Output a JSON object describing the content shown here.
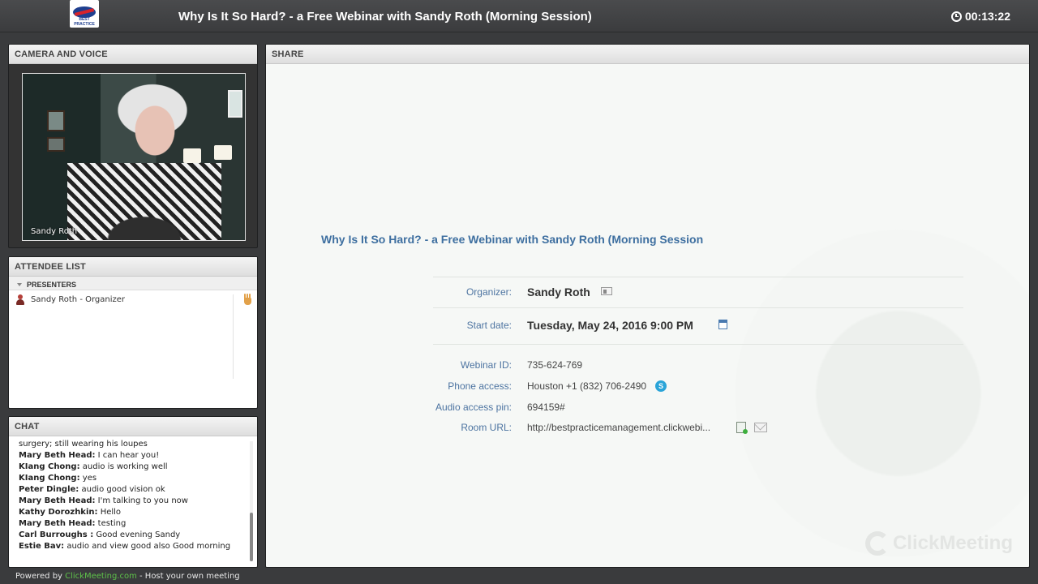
{
  "header": {
    "logo_text": "BEST PRACTICE",
    "title": "Why Is It So Hard? - a Free Webinar with Sandy Roth (Morning Session)",
    "timer": "00:13:22"
  },
  "camera": {
    "header": "CAMERA AND VOICE",
    "name_label": "Sandy Roth"
  },
  "attendees": {
    "header": "ATTENDEE LIST",
    "group": "PRESENTERS",
    "members": [
      {
        "name": "Sandy Roth - Organizer"
      }
    ]
  },
  "chat": {
    "header": "CHAT",
    "messages": [
      {
        "author": "",
        "text": "surgery; still wearing his loupes"
      },
      {
        "author": "Mary Beth Head:",
        "text": " I can hear you!"
      },
      {
        "author": "KIang  Chong:",
        "text": " audio is working well"
      },
      {
        "author": "KIang  Chong:",
        "text": " yes"
      },
      {
        "author": "Peter Dingle:",
        "text": " audio good vision ok"
      },
      {
        "author": "Mary Beth Head:",
        "text": " I'm talking to you now"
      },
      {
        "author": "Kathy Dorozhkin:",
        "text": " Hello"
      },
      {
        "author": "Mary Beth Head:",
        "text": " testing"
      },
      {
        "author": "Carl Burroughs :",
        "text": " Good evening Sandy"
      },
      {
        "author": "Estie Bav:",
        "text": " audio and view good also Good morning"
      }
    ]
  },
  "share": {
    "header": "SHARE",
    "webinar_title": "Why Is It So Hard? - a Free Webinar with Sandy Roth (Morning Session",
    "organizer_label": "Organizer:",
    "organizer": "Sandy Roth",
    "start_label": "Start date:",
    "start_date": "Tuesday, May 24, 2016 9:00 PM",
    "webinar_id_label": "Webinar ID:",
    "webinar_id": "735-624-769",
    "phone_label": "Phone access:",
    "phone": "Houston +1 (832) 706-2490",
    "pin_label": "Audio access pin:",
    "pin": "694159#",
    "room_label": "Room URL:",
    "room_url": "http://bestpracticemanagement.clickwebi...",
    "brand": "ClickMeeting"
  },
  "footer": {
    "prefix": "Powered by ",
    "link": "ClickMeeting.com",
    "suffix": " - Host your own meeting"
  }
}
